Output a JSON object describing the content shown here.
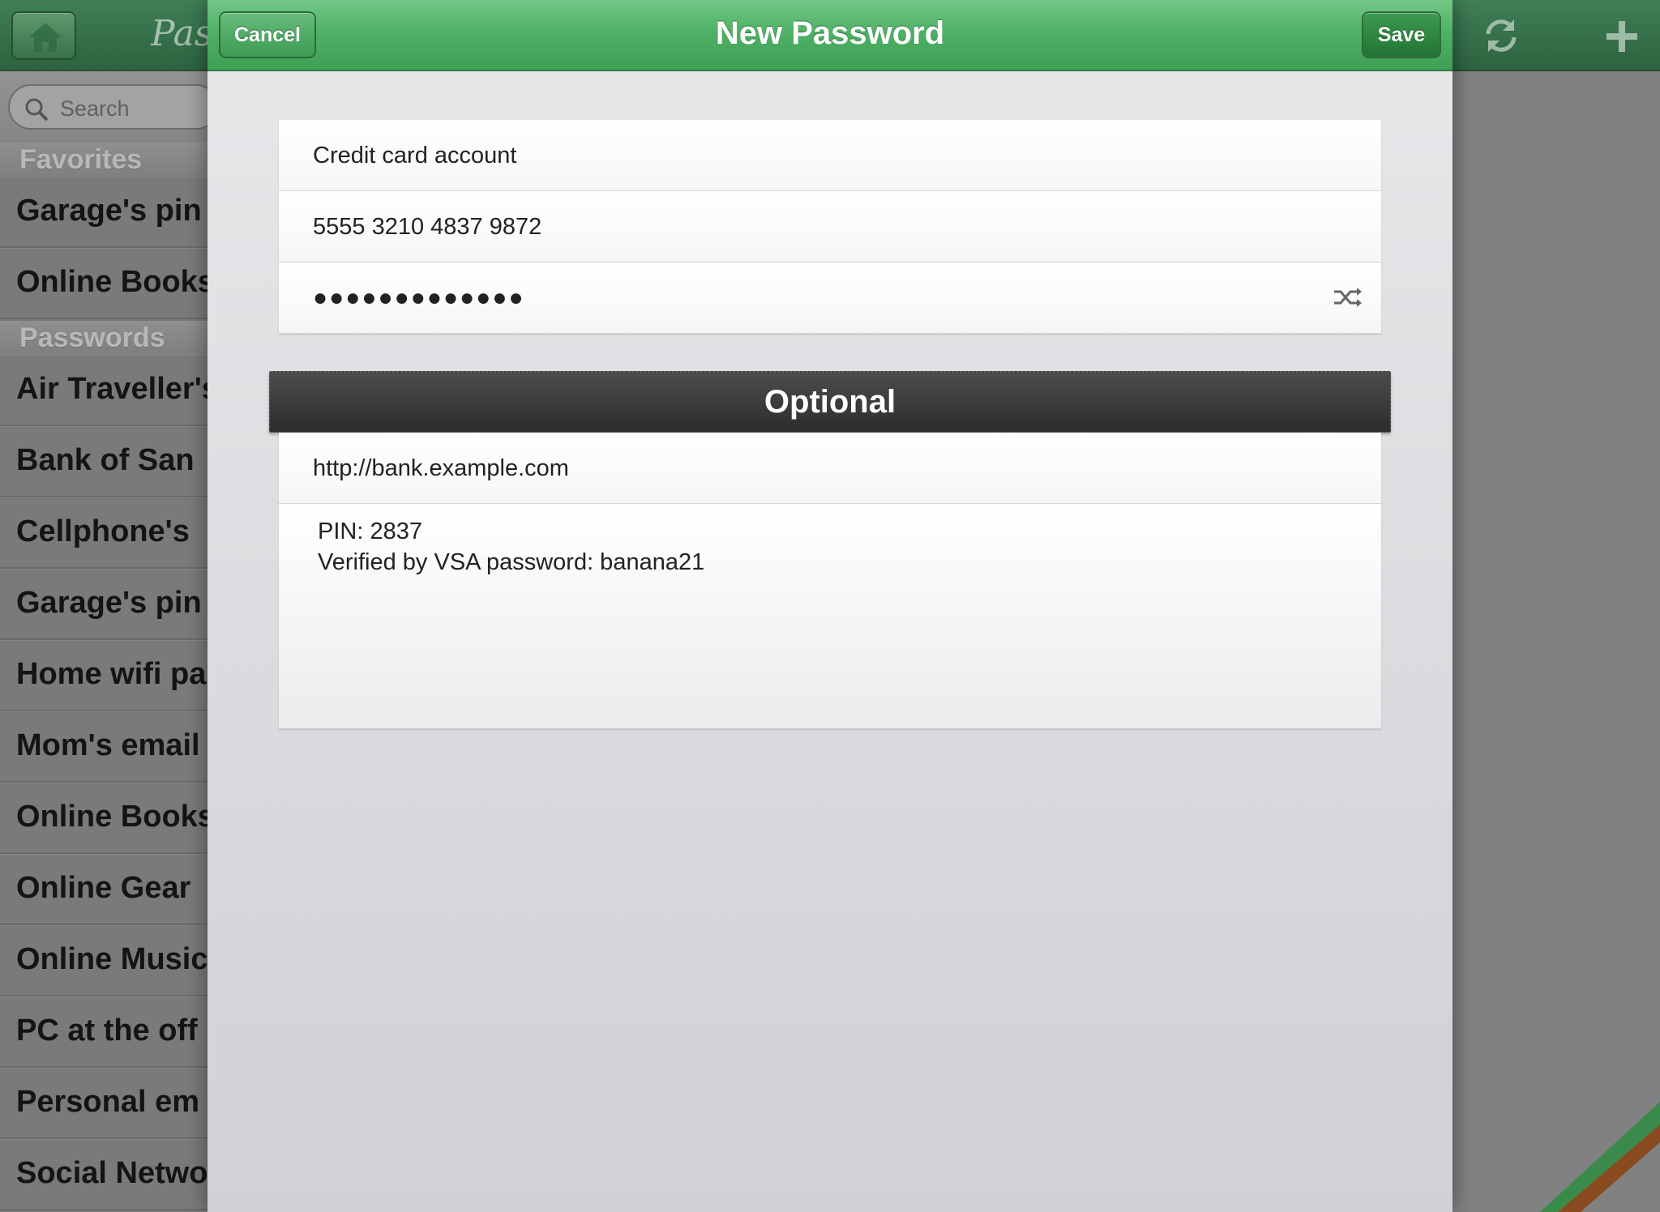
{
  "app": {
    "title": "Pas",
    "search_placeholder": "Search"
  },
  "sidebar": {
    "favorites_header": "Favorites",
    "favorites": [
      {
        "label": "Garage's pin"
      },
      {
        "label": "Online Books"
      }
    ],
    "passwords_header": "Passwords",
    "passwords": [
      {
        "label": "Air Traveller's"
      },
      {
        "label": "Bank of San"
      },
      {
        "label": "Cellphone's"
      },
      {
        "label": "Garage's pin"
      },
      {
        "label": "Home wifi pa"
      },
      {
        "label": "Mom's email"
      },
      {
        "label": "Online Books"
      },
      {
        "label": "Online Gear"
      },
      {
        "label": "Online Music"
      },
      {
        "label": "PC at the off"
      },
      {
        "label": "Personal em"
      },
      {
        "label": "Social Netwo"
      }
    ]
  },
  "modal": {
    "title": "New Password",
    "cancel_label": "Cancel",
    "save_label": "Save",
    "fields": {
      "title": "Credit card account",
      "username": "5555 3210 4837 9872",
      "password_masked": "●●●●●●●●●●●●●"
    },
    "optional_header": "Optional",
    "url": "http://bank.example.com",
    "notes_lines": [
      "PIN: 2837",
      "Verified by VSA password: banana21"
    ]
  },
  "colors": {
    "modal_bar": "#4fb166",
    "app_bar": "#2d6340",
    "optional_header": "#2d2d2d"
  },
  "icons": {
    "home": "home-icon",
    "sync": "sync-icon",
    "add": "plus-icon",
    "search": "search-icon",
    "shuffle": "shuffle-icon"
  }
}
